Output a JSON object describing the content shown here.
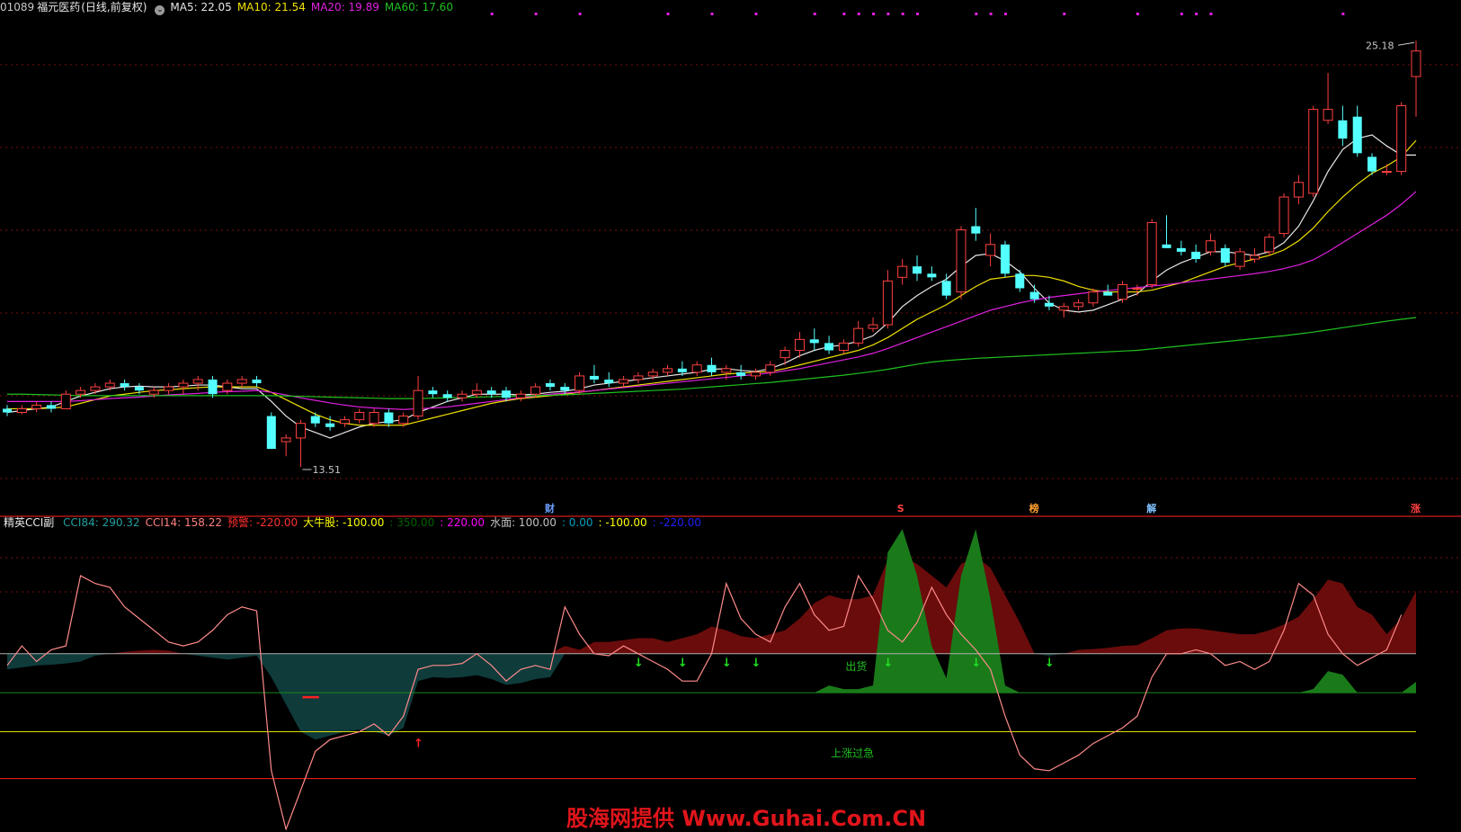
{
  "header": {
    "code": "01089",
    "name": "福元医药",
    "period": "(日线,前复权)",
    "ma": [
      {
        "label": "MA5:",
        "value": "22.05",
        "color": "#e6e6e6"
      },
      {
        "label": "MA10:",
        "value": "21.54",
        "color": "#f0e000"
      },
      {
        "label": "MA20:",
        "value": "19.89",
        "color": "#e020e0"
      },
      {
        "label": "MA60:",
        "value": "17.60",
        "color": "#20c020"
      }
    ]
  },
  "indicator_legend": {
    "name": "精英CCI副",
    "items": [
      {
        "text": "CCI84: 290.32",
        "color": "#20a0a0"
      },
      {
        "text": "CCI14: 158.22",
        "color": "#ff8080"
      },
      {
        "text": "预警: -220.00",
        "color": "#ff3030"
      },
      {
        "text": "大牛股: -100.00",
        "color": "#ffff00"
      },
      {
        "text": ": 350.00",
        "color": "#006000"
      },
      {
        "text": ": 220.00",
        "color": "#ff00ff"
      },
      {
        "text": "水面: 100.00",
        "color": "#c0c0c0"
      },
      {
        "text": ": 0.00",
        "color": "#00a0c0"
      },
      {
        "text": ": -100.00",
        "color": "#ffff00"
      },
      {
        "text": ": -220.00",
        "color": "#2020ff"
      }
    ]
  },
  "annotations": {
    "high_label": "25.18",
    "low_label": "13.51",
    "markers": [
      {
        "text": "财",
        "color": "#6aa0ff"
      },
      {
        "text": "S",
        "color": "#ff4040"
      },
      {
        "text": "榜",
        "color": "#ffa030"
      },
      {
        "text": "解",
        "color": "#7fc0ff"
      },
      {
        "text": "涨",
        "color": "#ff4040"
      }
    ],
    "sell_label": "出货",
    "rise_label": "上涨过急"
  },
  "watermark": "股海网提供 Www.Guhai.Com.CN",
  "chart_data": [
    {
      "type": "candlestick",
      "title": "福元医药 (日线,前复权)",
      "ylim": [
        12.5,
        26
      ],
      "high": 25.18,
      "low": 13.51,
      "ohlc": [
        [
          15.1,
          15.2,
          14.9,
          15.0
        ],
        [
          15.0,
          15.2,
          14.95,
          15.1
        ],
        [
          15.1,
          15.3,
          15.0,
          15.2
        ],
        [
          15.2,
          15.3,
          15.0,
          15.1
        ],
        [
          15.1,
          15.6,
          15.1,
          15.5
        ],
        [
          15.5,
          15.7,
          15.4,
          15.6
        ],
        [
          15.6,
          15.8,
          15.5,
          15.7
        ],
        [
          15.7,
          15.9,
          15.6,
          15.8
        ],
        [
          15.8,
          15.9,
          15.6,
          15.7
        ],
        [
          15.7,
          15.8,
          15.5,
          15.6
        ],
        [
          15.5,
          15.7,
          15.4,
          15.6
        ],
        [
          15.6,
          15.8,
          15.5,
          15.7
        ],
        [
          15.7,
          15.9,
          15.5,
          15.8
        ],
        [
          15.8,
          16.0,
          15.6,
          15.9
        ],
        [
          15.9,
          16.0,
          15.4,
          15.5
        ],
        [
          15.6,
          15.9,
          15.5,
          15.8
        ],
        [
          15.8,
          16.0,
          15.7,
          15.9
        ],
        [
          15.9,
          16.0,
          15.7,
          15.8
        ],
        [
          14.9,
          15.0,
          14.0,
          14.0
        ],
        [
          14.2,
          14.4,
          13.8,
          14.3
        ],
        [
          14.3,
          14.8,
          13.51,
          14.7
        ],
        [
          14.9,
          15.0,
          14.6,
          14.7
        ],
        [
          14.7,
          14.9,
          14.5,
          14.6
        ],
        [
          14.7,
          14.9,
          14.6,
          14.8
        ],
        [
          14.8,
          15.1,
          14.7,
          15.0
        ],
        [
          14.7,
          15.1,
          14.6,
          15.0
        ],
        [
          15.0,
          15.1,
          14.6,
          14.7
        ],
        [
          14.7,
          15.0,
          14.6,
          14.9
        ],
        [
          14.9,
          16.0,
          14.8,
          15.6
        ],
        [
          15.6,
          15.7,
          15.4,
          15.5
        ],
        [
          15.5,
          15.6,
          15.3,
          15.4
        ],
        [
          15.4,
          15.6,
          15.3,
          15.5
        ],
        [
          15.5,
          15.8,
          15.4,
          15.6
        ],
        [
          15.6,
          15.7,
          15.4,
          15.5
        ],
        [
          15.6,
          15.7,
          15.3,
          15.4
        ],
        [
          15.4,
          15.6,
          15.3,
          15.5
        ],
        [
          15.5,
          15.8,
          15.4,
          15.7
        ],
        [
          15.8,
          15.9,
          15.6,
          15.7
        ],
        [
          15.7,
          15.8,
          15.5,
          15.6
        ],
        [
          15.6,
          16.1,
          15.5,
          16.0
        ],
        [
          16.0,
          16.3,
          15.8,
          15.9
        ],
        [
          15.9,
          16.1,
          15.7,
          15.8
        ],
        [
          15.8,
          16.0,
          15.7,
          15.9
        ],
        [
          15.9,
          16.1,
          15.8,
          16.0
        ],
        [
          16.0,
          16.2,
          15.9,
          16.1
        ],
        [
          16.1,
          16.3,
          16.0,
          16.2
        ],
        [
          16.2,
          16.4,
          16.0,
          16.1
        ],
        [
          16.1,
          16.4,
          16.0,
          16.3
        ],
        [
          16.3,
          16.5,
          16.0,
          16.1
        ],
        [
          16.1,
          16.3,
          15.9,
          16.2
        ],
        [
          16.1,
          16.3,
          15.9,
          16.0
        ],
        [
          16.0,
          16.2,
          15.9,
          16.1
        ],
        [
          16.1,
          16.4,
          16.0,
          16.3
        ],
        [
          16.5,
          16.8,
          16.3,
          16.7
        ],
        [
          16.7,
          17.2,
          16.5,
          17.0
        ],
        [
          17.0,
          17.3,
          16.7,
          16.9
        ],
        [
          16.9,
          17.1,
          16.6,
          16.7
        ],
        [
          16.7,
          17.0,
          16.6,
          16.9
        ],
        [
          16.9,
          17.5,
          16.8,
          17.3
        ],
        [
          17.3,
          17.6,
          17.2,
          17.4
        ],
        [
          17.4,
          18.9,
          17.3,
          18.6
        ],
        [
          18.7,
          19.2,
          18.5,
          19.0
        ],
        [
          19.0,
          19.3,
          18.6,
          18.8
        ],
        [
          18.8,
          19.0,
          18.6,
          18.7
        ],
        [
          18.6,
          18.8,
          18.1,
          18.2
        ],
        [
          18.3,
          20.1,
          18.1,
          20.0
        ],
        [
          20.1,
          20.6,
          19.7,
          19.9
        ],
        [
          19.3,
          19.9,
          19.0,
          19.6
        ],
        [
          19.6,
          19.7,
          18.7,
          18.8
        ],
        [
          18.8,
          18.9,
          18.3,
          18.4
        ],
        [
          18.3,
          18.5,
          18.0,
          18.1
        ],
        [
          18.0,
          18.2,
          17.8,
          17.9
        ],
        [
          17.8,
          18.0,
          17.6,
          17.9
        ],
        [
          17.9,
          18.1,
          17.8,
          18.0
        ],
        [
          18.0,
          18.4,
          17.9,
          18.3
        ],
        [
          18.3,
          18.5,
          18.2,
          18.2
        ],
        [
          18.1,
          18.6,
          18.0,
          18.5
        ],
        [
          18.4,
          18.5,
          18.2,
          18.4
        ],
        [
          18.5,
          20.3,
          18.4,
          20.2
        ],
        [
          19.6,
          20.4,
          19.5,
          19.5
        ],
        [
          19.5,
          19.7,
          19.3,
          19.4
        ],
        [
          19.4,
          19.6,
          19.1,
          19.2
        ],
        [
          19.4,
          19.9,
          19.3,
          19.7
        ],
        [
          19.5,
          19.6,
          19.0,
          19.1
        ],
        [
          19.0,
          19.5,
          18.9,
          19.4
        ],
        [
          19.2,
          19.5,
          19.1,
          19.3
        ],
        [
          19.4,
          19.9,
          19.3,
          19.8
        ],
        [
          19.9,
          21.0,
          19.8,
          20.9
        ],
        [
          20.9,
          21.5,
          20.7,
          21.3
        ],
        [
          21.0,
          23.4,
          20.9,
          23.3
        ],
        [
          23.0,
          24.3,
          22.9,
          23.3
        ],
        [
          23.0,
          23.4,
          22.3,
          22.5
        ],
        [
          23.1,
          23.4,
          22.0,
          22.1
        ],
        [
          22.0,
          22.1,
          21.5,
          21.6
        ],
        [
          21.6,
          21.8,
          21.5,
          21.6
        ],
        [
          21.6,
          23.5,
          21.5,
          23.4
        ],
        [
          24.2,
          25.18,
          23.1,
          24.9
        ]
      ],
      "ma": {
        "MA5": [
          15.0,
          15.05,
          15.1,
          15.15,
          15.3,
          15.45,
          15.55,
          15.65,
          15.7,
          15.72,
          15.7,
          15.7,
          15.72,
          15.75,
          15.75,
          15.7,
          15.65,
          15.65,
          15.3,
          14.9,
          14.6,
          14.45,
          14.3,
          14.45,
          14.6,
          14.7,
          14.75,
          14.8,
          15.0,
          15.15,
          15.3,
          15.4,
          15.5,
          15.5,
          15.5,
          15.48,
          15.5,
          15.55,
          15.58,
          15.65,
          15.75,
          15.8,
          15.85,
          15.9,
          15.95,
          16.0,
          16.05,
          16.1,
          16.18,
          16.2,
          16.15,
          16.12,
          16.2,
          16.35,
          16.55,
          16.7,
          16.8,
          16.85,
          16.95,
          17.1,
          17.45,
          17.9,
          18.2,
          18.45,
          18.65,
          19.0,
          19.3,
          19.35,
          19.15,
          18.85,
          18.4,
          18.0,
          17.8,
          17.75,
          17.8,
          17.95,
          18.1,
          18.25,
          18.6,
          18.9,
          19.1,
          19.25,
          19.4,
          19.4,
          19.35,
          19.3,
          19.4,
          19.65,
          20.1,
          20.8,
          21.6,
          22.2,
          22.5,
          22.6,
          22.3,
          22.05,
          22.05
        ],
        "MA10": [
          15.1,
          15.1,
          15.1,
          15.12,
          15.15,
          15.25,
          15.35,
          15.45,
          15.5,
          15.55,
          15.6,
          15.62,
          15.65,
          15.68,
          15.7,
          15.7,
          15.7,
          15.7,
          15.55,
          15.35,
          15.15,
          14.95,
          14.8,
          14.7,
          14.65,
          14.65,
          14.65,
          14.65,
          14.75,
          14.85,
          14.95,
          15.05,
          15.15,
          15.25,
          15.32,
          15.38,
          15.42,
          15.46,
          15.5,
          15.55,
          15.6,
          15.65,
          15.7,
          15.75,
          15.8,
          15.85,
          15.9,
          15.95,
          16.0,
          16.05,
          16.08,
          16.1,
          16.12,
          16.2,
          16.3,
          16.4,
          16.5,
          16.6,
          16.7,
          16.85,
          17.05,
          17.3,
          17.55,
          17.75,
          17.95,
          18.2,
          18.45,
          18.65,
          18.7,
          18.75,
          18.75,
          18.7,
          18.6,
          18.45,
          18.35,
          18.3,
          18.3,
          18.3,
          18.35,
          18.45,
          18.55,
          18.7,
          18.85,
          19.0,
          19.1,
          19.2,
          19.3,
          19.45,
          19.7,
          20.05,
          20.5,
          20.9,
          21.25,
          21.55,
          21.75,
          22.0,
          22.45
        ],
        "MA20": [
          15.3,
          15.3,
          15.3,
          15.3,
          15.3,
          15.32,
          15.35,
          15.38,
          15.4,
          15.42,
          15.45,
          15.48,
          15.5,
          15.52,
          15.55,
          15.57,
          15.58,
          15.6,
          15.55,
          15.48,
          15.4,
          15.33,
          15.26,
          15.2,
          15.15,
          15.12,
          15.1,
          15.08,
          15.1,
          15.12,
          15.15,
          15.2,
          15.25,
          15.3,
          15.35,
          15.4,
          15.45,
          15.5,
          15.53,
          15.56,
          15.6,
          15.64,
          15.68,
          15.72,
          15.76,
          15.8,
          15.84,
          15.88,
          15.92,
          15.96,
          16.0,
          16.04,
          16.08,
          16.14,
          16.2,
          16.28,
          16.36,
          16.44,
          16.52,
          16.62,
          16.75,
          16.9,
          17.05,
          17.2,
          17.35,
          17.5,
          17.65,
          17.8,
          17.9,
          18.0,
          18.08,
          18.15,
          18.2,
          18.25,
          18.3,
          18.34,
          18.38,
          18.42,
          18.46,
          18.5,
          18.55,
          18.6,
          18.65,
          18.7,
          18.75,
          18.8,
          18.86,
          18.94,
          19.04,
          19.18,
          19.4,
          19.65,
          19.9,
          20.15,
          20.4,
          20.7,
          21.05
        ],
        "MA60": [
          15.5,
          15.5,
          15.49,
          15.48,
          15.47,
          15.46,
          15.46,
          15.46,
          15.46,
          15.46,
          15.46,
          15.46,
          15.46,
          15.46,
          15.46,
          15.46,
          15.46,
          15.46,
          15.46,
          15.45,
          15.44,
          15.43,
          15.42,
          15.41,
          15.4,
          15.39,
          15.38,
          15.38,
          15.38,
          15.39,
          15.4,
          15.41,
          15.42,
          15.43,
          15.44,
          15.45,
          15.46,
          15.47,
          15.48,
          15.5,
          15.52,
          15.54,
          15.56,
          15.58,
          15.6,
          15.62,
          15.64,
          15.67,
          15.7,
          15.73,
          15.76,
          15.79,
          15.82,
          15.86,
          15.9,
          15.94,
          15.98,
          16.02,
          16.07,
          16.12,
          16.18,
          16.25,
          16.32,
          16.38,
          16.42,
          16.45,
          16.48,
          16.5,
          16.52,
          16.54,
          16.56,
          16.58,
          16.6,
          16.62,
          16.64,
          16.66,
          16.68,
          16.7,
          16.74,
          16.78,
          16.82,
          16.86,
          16.9,
          16.94,
          16.98,
          17.02,
          17.06,
          17.1,
          17.15,
          17.2,
          17.26,
          17.32,
          17.38,
          17.44,
          17.5,
          17.55,
          17.6
        ]
      }
    },
    {
      "type": "area",
      "title": "精英CCI副",
      "ylim": [
        -350,
        420
      ],
      "levels": [
        350,
        220,
        100,
        0,
        -100,
        -220
      ],
      "cci84": [
        60,
        65,
        70,
        72,
        75,
        80,
        95,
        100,
        105,
        108,
        110,
        108,
        100,
        95,
        90,
        85,
        90,
        95,
        40,
        -30,
        -100,
        -120,
        -110,
        -100,
        -95,
        -100,
        -110,
        -90,
        30,
        40,
        38,
        40,
        45,
        35,
        20,
        25,
        35,
        40,
        120,
        110,
        130,
        130,
        135,
        140,
        140,
        130,
        140,
        150,
        170,
        160,
        145,
        140,
        150,
        160,
        190,
        230,
        250,
        240,
        240,
        250,
        340,
        350,
        330,
        300,
        270,
        330,
        350,
        320,
        250,
        180,
        100,
        95,
        100,
        110,
        112,
        115,
        120,
        122,
        140,
        160,
        165,
        165,
        160,
        155,
        150,
        150,
        160,
        175,
        195,
        240,
        290,
        280,
        220,
        200,
        150,
        190,
        260
      ],
      "cci14": [
        70,
        120,
        80,
        110,
        120,
        300,
        280,
        270,
        220,
        190,
        160,
        130,
        120,
        130,
        160,
        200,
        220,
        210,
        -200,
        -350,
        -250,
        -150,
        -120,
        -110,
        -100,
        -80,
        -110,
        -60,
        60,
        70,
        70,
        75,
        100,
        70,
        30,
        60,
        70,
        60,
        220,
        150,
        100,
        95,
        120,
        100,
        80,
        60,
        30,
        30,
        100,
        280,
        190,
        150,
        130,
        220,
        280,
        200,
        160,
        170,
        300,
        240,
        160,
        130,
        180,
        270,
        200,
        150,
        110,
        60,
        -60,
        -160,
        -195,
        -200,
        -180,
        -160,
        -130,
        -110,
        -90,
        -60,
        40,
        100,
        100,
        110,
        100,
        70,
        80,
        60,
        80,
        160,
        280,
        250,
        150,
        100,
        70,
        90,
        110,
        200
      ]
    }
  ]
}
